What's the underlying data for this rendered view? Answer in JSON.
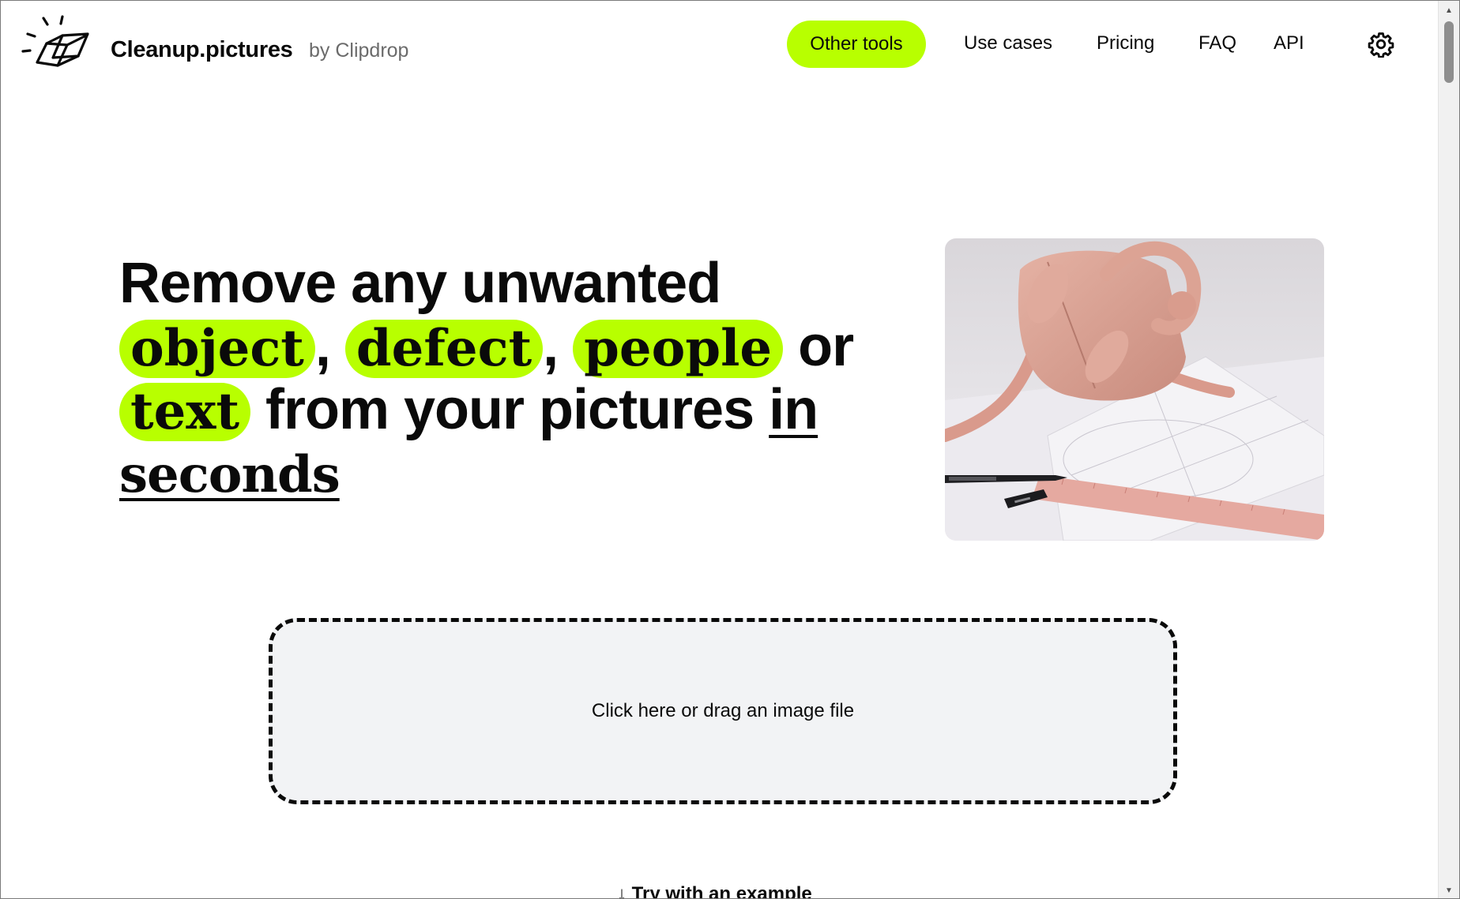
{
  "header": {
    "brand": "Cleanup.pictures",
    "brand_by": "by Clipdrop",
    "nav": {
      "other_tools": "Other tools",
      "use_cases": "Use cases",
      "pricing": "Pricing",
      "faq": "FAQ",
      "api": "API"
    },
    "logo_icon": "eraser-icon",
    "settings_icon": "gear-icon"
  },
  "hero": {
    "line1": "Remove any unwanted",
    "word_object": "object",
    "comma1": ",",
    "word_defect": "defect",
    "comma2": ",",
    "word_people": "people",
    "word_or": "or",
    "word_text": "text",
    "middle": "from your pictures",
    "word_in": "in",
    "word_seconds": "seconds",
    "image_text_brand": "YUZEFI",
    "image_text_sub": "DOROLES"
  },
  "upload": {
    "label": "Click here or drag an image file",
    "example": "Try with an example",
    "example_icon": "arrow-down-icon"
  },
  "colors": {
    "accent": "#b8ff00",
    "text": "#0a0a0a",
    "muted": "#6b6b6b",
    "dropzone_bg": "#f2f3f5"
  }
}
